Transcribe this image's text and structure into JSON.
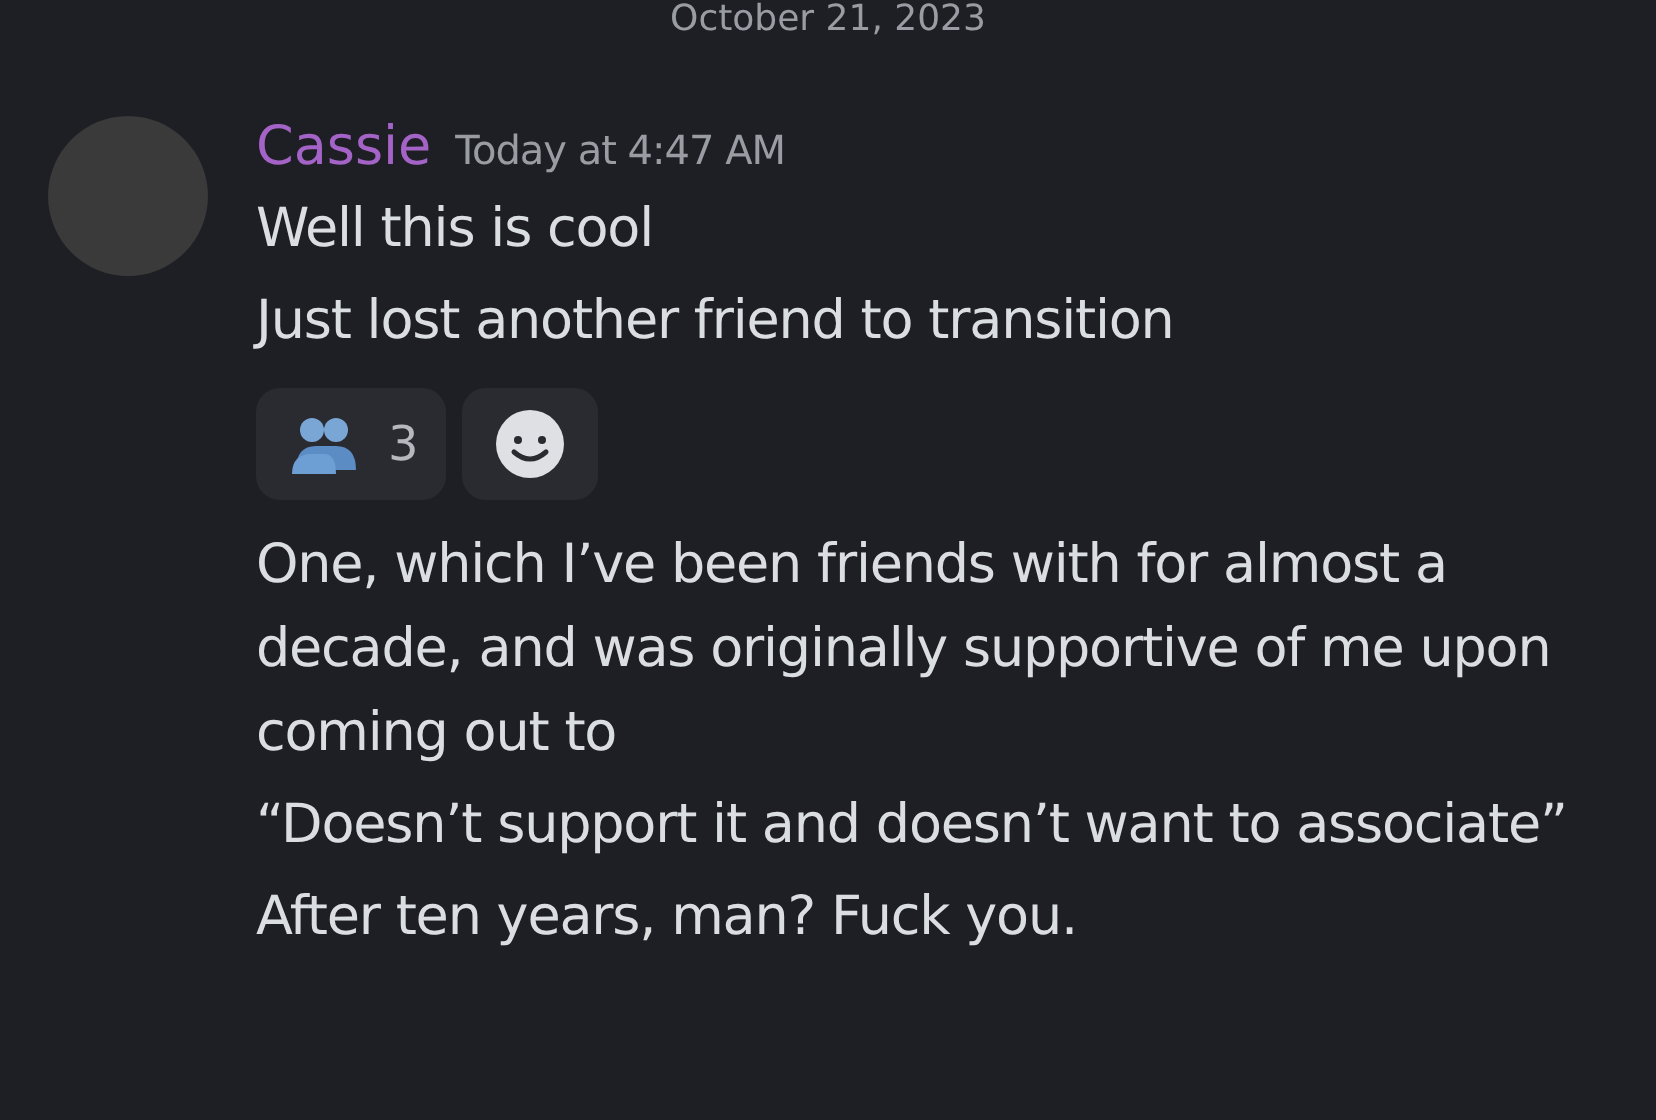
{
  "date_divider": "October 21, 2023",
  "message_group": {
    "author": "Cassie",
    "timestamp": "Today at 4:47 AM",
    "items": [
      {
        "kind": "text",
        "text": "Well this is cool"
      },
      {
        "kind": "text",
        "text": "Just lost another friend to transition"
      },
      {
        "kind": "reactions",
        "reactions": [
          {
            "kind": "emoji",
            "count": "3"
          },
          {
            "kind": "add"
          }
        ]
      },
      {
        "kind": "text",
        "text": "One, which I’ve been friends with for almost a decade, and was originally supportive of me upon coming out to"
      },
      {
        "kind": "text",
        "text": "“Doesn’t support it and doesn’t want to associate”"
      },
      {
        "kind": "text",
        "text": "After ten years, man? Fuck you."
      }
    ]
  }
}
